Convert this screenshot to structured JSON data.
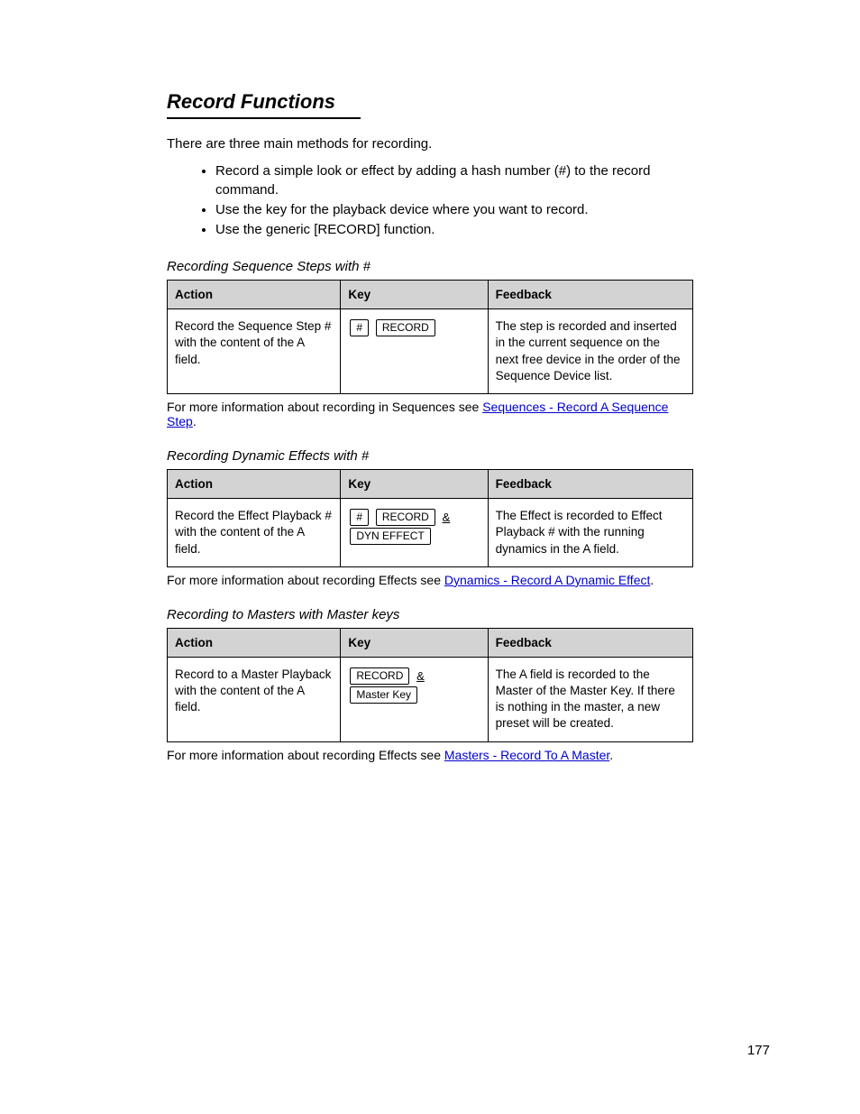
{
  "header": {
    "title": "Record Functions"
  },
  "intro": {
    "lead": "There are three main methods for recording.",
    "bullets": [
      "Record a simple look or effect by adding a hash number (#) to the record command.",
      "Use the key for the playback device where you want to record.",
      "Use the generic [RECORD] function."
    ]
  },
  "sections": [
    {
      "heading": "Recording Sequence Steps with #",
      "table": {
        "headers": [
          "Action",
          "Key",
          "Feedback"
        ],
        "row": {
          "action": "Record the Sequence Step # with the content of the A field.",
          "keys_html": "<span class=\"keycap\">#</span> <span class=\"keycap\">RECORD</span>",
          "feedback": "The step is recorded and inserted in the current sequence on the next free device in the order of the Sequence Device list."
        }
      },
      "caption_prefix": "For more information about recording in Sequences see ",
      "link_text": "Sequences - Record A Sequence Step",
      "caption_suffix": "."
    },
    {
      "heading": "Recording Dynamic Effects with #",
      "table": {
        "headers": [
          "Action",
          "Key",
          "Feedback"
        ],
        "row": {
          "action": "Record the Effect Playback # with the content of the A field.",
          "keys_html": "<span class=\"keycap\">#</span> <span class=\"keycap\">RECORD</span> <span class=\"amp\">&amp;</span><br><span class=\"keycap\">DYN EFFECT</span>",
          "feedback": "The Effect is recorded to Effect Playback # with the running dynamics in the A field."
        }
      },
      "caption_prefix": "For more information about recording Effects see ",
      "link_text": "Dynamics - Record A Dynamic Effect",
      "caption_suffix": "."
    },
    {
      "heading": "Recording to Masters with Master keys",
      "table": {
        "headers": [
          "Action",
          "Key",
          "Feedback"
        ],
        "row": {
          "action": "Record to a Master Playback with the content of the A field.",
          "keys_html": "<span class=\"keycap\">RECORD</span> <span class=\"amp\">&amp;</span><br><span class=\"keycap\">Master Key</span>",
          "feedback": "The A field is recorded to the Master of the Master Key. If there is nothing in the master, a new preset will be created."
        }
      },
      "caption_prefix": "For more information about recording Effects see ",
      "link_text": "Masters - Record To A Master",
      "caption_suffix": "."
    }
  ],
  "footer": {
    "page_number": "177"
  }
}
